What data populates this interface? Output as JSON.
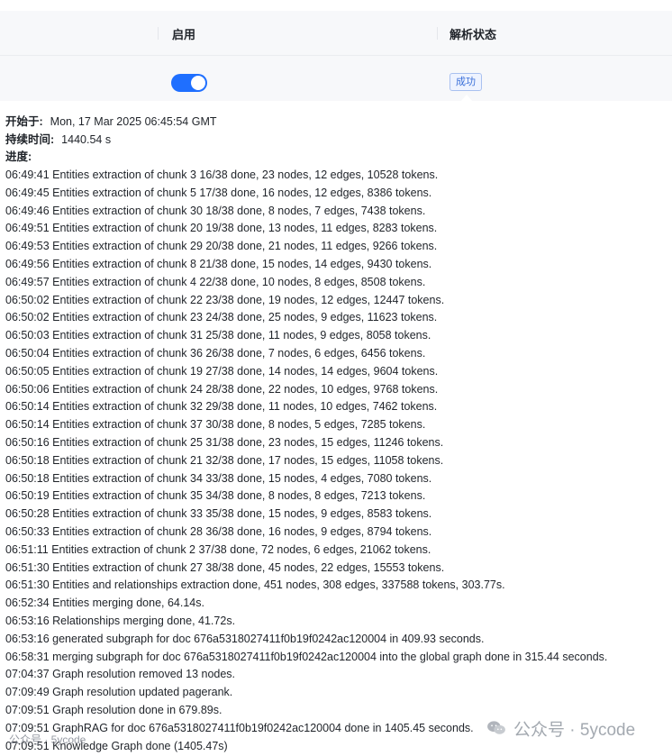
{
  "table": {
    "headers": {
      "enable": "启用",
      "status": "解析状态"
    },
    "row": {
      "enabled": true,
      "status": "成功"
    }
  },
  "popover": {
    "start_label": "开始于:",
    "start_value": "Mon, 17 Mar 2025 06:45:54 GMT",
    "duration_label": "持续时间:",
    "duration_value": "1440.54 s",
    "progress_label": "进度:",
    "progress_lines": [
      "06:49:41 Entities extraction of chunk 3 16/38 done, 23 nodes, 12 edges, 10528 tokens.",
      "06:49:45 Entities extraction of chunk 5 17/38 done, 16 nodes, 12 edges, 8386 tokens.",
      "06:49:46 Entities extraction of chunk 30 18/38 done, 8 nodes, 7 edges, 7438 tokens.",
      "06:49:51 Entities extraction of chunk 20 19/38 done, 13 nodes, 11 edges, 8283 tokens.",
      "06:49:53 Entities extraction of chunk 29 20/38 done, 21 nodes, 11 edges, 9266 tokens.",
      "06:49:56 Entities extraction of chunk 8 21/38 done, 15 nodes, 14 edges, 9430 tokens.",
      "06:49:57 Entities extraction of chunk 4 22/38 done, 10 nodes, 8 edges, 8508 tokens.",
      "06:50:02 Entities extraction of chunk 22 23/38 done, 19 nodes, 12 edges, 12447 tokens.",
      "06:50:02 Entities extraction of chunk 23 24/38 done, 25 nodes, 9 edges, 11623 tokens.",
      "06:50:03 Entities extraction of chunk 31 25/38 done, 11 nodes, 9 edges, 8058 tokens.",
      "06:50:04 Entities extraction of chunk 36 26/38 done, 7 nodes, 6 edges, 6456 tokens.",
      "06:50:05 Entities extraction of chunk 19 27/38 done, 14 nodes, 14 edges, 9604 tokens.",
      "06:50:06 Entities extraction of chunk 24 28/38 done, 22 nodes, 10 edges, 9768 tokens.",
      "06:50:14 Entities extraction of chunk 32 29/38 done, 11 nodes, 10 edges, 7462 tokens.",
      "06:50:14 Entities extraction of chunk 37 30/38 done, 8 nodes, 5 edges, 7285 tokens.",
      "06:50:16 Entities extraction of chunk 25 31/38 done, 23 nodes, 15 edges, 11246 tokens.",
      "06:50:18 Entities extraction of chunk 21 32/38 done, 17 nodes, 15 edges, 11058 tokens.",
      "06:50:18 Entities extraction of chunk 34 33/38 done, 15 nodes, 4 edges, 7080 tokens.",
      "06:50:19 Entities extraction of chunk 35 34/38 done, 8 nodes, 8 edges, 7213 tokens.",
      "06:50:28 Entities extraction of chunk 33 35/38 done, 15 nodes, 9 edges, 8583 tokens.",
      "06:50:33 Entities extraction of chunk 28 36/38 done, 16 nodes, 9 edges, 8794 tokens.",
      "06:51:11 Entities extraction of chunk 2 37/38 done, 72 nodes, 6 edges, 21062 tokens.",
      "06:51:30 Entities extraction of chunk 27 38/38 done, 45 nodes, 22 edges, 15553 tokens.",
      "06:51:30 Entities and relationships extraction done, 451 nodes, 308 edges, 337588 tokens, 303.77s.",
      "06:52:34 Entities merging done, 64.14s.",
      "06:53:16 Relationships merging done, 41.72s.",
      "06:53:16 generated subgraph for doc 676a5318027411f0b19f0242ac120004 in 409.93 seconds.",
      "06:58:31 merging subgraph for doc 676a5318027411f0b19f0242ac120004 into the global graph done in 315.44 seconds.",
      "07:04:37 Graph resolution removed 13 nodes.",
      "07:09:49 Graph resolution updated pagerank.",
      "07:09:51 Graph resolution done in 679.89s.",
      "07:09:51 GraphRAG for doc 676a5318027411f0b19f0242ac120004 done in 1405.45 seconds.",
      "07:09:51 Knowledge Graph done (1405.47s)"
    ]
  },
  "watermark": {
    "left": "公众号 · 5ycode",
    "right": "公众号 · 5ycode"
  },
  "colors": {
    "accent": "#1f6fff",
    "badge_text": "#3a6fd8",
    "badge_bg": "#eef3ff"
  }
}
